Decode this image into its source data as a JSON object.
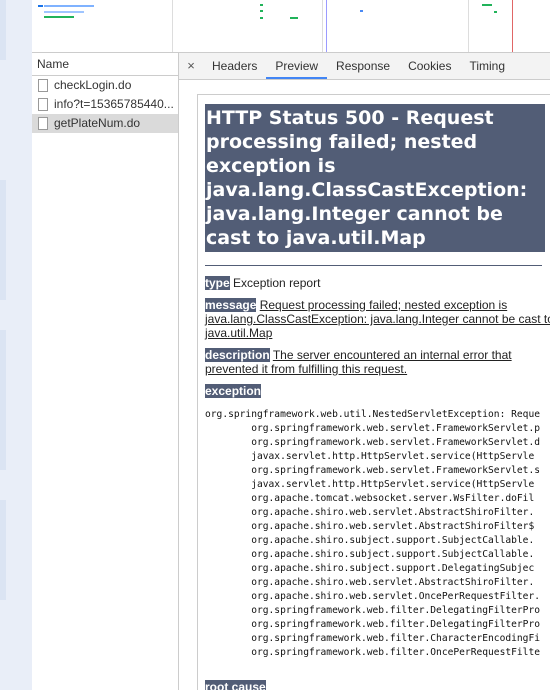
{
  "network": {
    "name_header": "Name",
    "requests": [
      {
        "name": "checkLogin.do",
        "selected": false
      },
      {
        "name": "info?t=15365785440...",
        "selected": false
      },
      {
        "name": "getPlateNum.do",
        "selected": true
      }
    ]
  },
  "tabs": {
    "close": "×",
    "items": [
      "Headers",
      "Preview",
      "Response",
      "Cookies",
      "Timing"
    ],
    "active": "Preview"
  },
  "preview": {
    "title": "HTTP Status 500 - Request processing failed; nested exception is java.lang.ClassCastException: java.lang.Integer cannot be cast to java.util.Map",
    "type_label": "type",
    "type_text": "Exception report",
    "message_label": "message",
    "message_text": "Request processing failed; nested exception is java.lang.ClassCastException: java.lang.Integer cannot be cast to java.util.Map",
    "description_label": "description",
    "description_text": "The server encountered an internal error that prevented it from fulfilling this request.",
    "exception_label": "exception",
    "trace": [
      "org.springframework.web.util.NestedServletException: Reque",
      "\torg.springframework.web.servlet.FrameworkServlet.p",
      "\torg.springframework.web.servlet.FrameworkServlet.d",
      "\tjavax.servlet.http.HttpServlet.service(HttpServle",
      "\torg.springframework.web.servlet.FrameworkServlet.s",
      "\tjavax.servlet.http.HttpServlet.service(HttpServle",
      "\torg.apache.tomcat.websocket.server.WsFilter.doFil",
      "\torg.apache.shiro.web.servlet.AbstractShiroFilter.",
      "\torg.apache.shiro.web.servlet.AbstractShiroFilter$",
      "\torg.apache.shiro.subject.support.SubjectCallable.",
      "\torg.apache.shiro.subject.support.SubjectCallable.",
      "\torg.apache.shiro.subject.support.DelegatingSubjec",
      "\torg.apache.shiro.web.servlet.AbstractShiroFilter.",
      "\torg.apache.shiro.web.servlet.OncePerRequestFilter.",
      "\torg.springframework.web.filter.DelegatingFilterPro",
      "\torg.springframework.web.filter.DelegatingFilterPro",
      "\torg.springframework.web.filter.CharacterEncodingFi",
      "\torg.springframework.web.filter.OncePerRequestFilte"
    ],
    "root_cause_label": "root cause"
  },
  "colors": {
    "title_bg": "#525d76",
    "active_tab": "#4285f4"
  }
}
